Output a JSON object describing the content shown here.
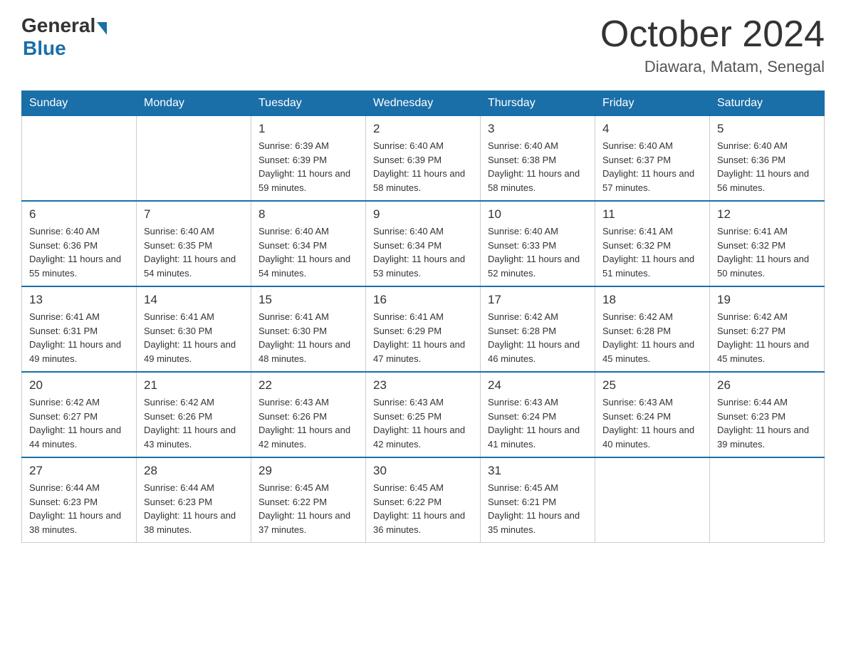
{
  "header": {
    "logo": {
      "general": "General",
      "blue": "Blue"
    },
    "title": "October 2024",
    "location": "Diawara, Matam, Senegal"
  },
  "days_of_week": [
    "Sunday",
    "Monday",
    "Tuesday",
    "Wednesday",
    "Thursday",
    "Friday",
    "Saturday"
  ],
  "weeks": [
    [
      {
        "day": "",
        "sunrise": "",
        "sunset": "",
        "daylight": ""
      },
      {
        "day": "",
        "sunrise": "",
        "sunset": "",
        "daylight": ""
      },
      {
        "day": "1",
        "sunrise": "Sunrise: 6:39 AM",
        "sunset": "Sunset: 6:39 PM",
        "daylight": "Daylight: 11 hours and 59 minutes."
      },
      {
        "day": "2",
        "sunrise": "Sunrise: 6:40 AM",
        "sunset": "Sunset: 6:39 PM",
        "daylight": "Daylight: 11 hours and 58 minutes."
      },
      {
        "day": "3",
        "sunrise": "Sunrise: 6:40 AM",
        "sunset": "Sunset: 6:38 PM",
        "daylight": "Daylight: 11 hours and 58 minutes."
      },
      {
        "day": "4",
        "sunrise": "Sunrise: 6:40 AM",
        "sunset": "Sunset: 6:37 PM",
        "daylight": "Daylight: 11 hours and 57 minutes."
      },
      {
        "day": "5",
        "sunrise": "Sunrise: 6:40 AM",
        "sunset": "Sunset: 6:36 PM",
        "daylight": "Daylight: 11 hours and 56 minutes."
      }
    ],
    [
      {
        "day": "6",
        "sunrise": "Sunrise: 6:40 AM",
        "sunset": "Sunset: 6:36 PM",
        "daylight": "Daylight: 11 hours and 55 minutes."
      },
      {
        "day": "7",
        "sunrise": "Sunrise: 6:40 AM",
        "sunset": "Sunset: 6:35 PM",
        "daylight": "Daylight: 11 hours and 54 minutes."
      },
      {
        "day": "8",
        "sunrise": "Sunrise: 6:40 AM",
        "sunset": "Sunset: 6:34 PM",
        "daylight": "Daylight: 11 hours and 54 minutes."
      },
      {
        "day": "9",
        "sunrise": "Sunrise: 6:40 AM",
        "sunset": "Sunset: 6:34 PM",
        "daylight": "Daylight: 11 hours and 53 minutes."
      },
      {
        "day": "10",
        "sunrise": "Sunrise: 6:40 AM",
        "sunset": "Sunset: 6:33 PM",
        "daylight": "Daylight: 11 hours and 52 minutes."
      },
      {
        "day": "11",
        "sunrise": "Sunrise: 6:41 AM",
        "sunset": "Sunset: 6:32 PM",
        "daylight": "Daylight: 11 hours and 51 minutes."
      },
      {
        "day": "12",
        "sunrise": "Sunrise: 6:41 AM",
        "sunset": "Sunset: 6:32 PM",
        "daylight": "Daylight: 11 hours and 50 minutes."
      }
    ],
    [
      {
        "day": "13",
        "sunrise": "Sunrise: 6:41 AM",
        "sunset": "Sunset: 6:31 PM",
        "daylight": "Daylight: 11 hours and 49 minutes."
      },
      {
        "day": "14",
        "sunrise": "Sunrise: 6:41 AM",
        "sunset": "Sunset: 6:30 PM",
        "daylight": "Daylight: 11 hours and 49 minutes."
      },
      {
        "day": "15",
        "sunrise": "Sunrise: 6:41 AM",
        "sunset": "Sunset: 6:30 PM",
        "daylight": "Daylight: 11 hours and 48 minutes."
      },
      {
        "day": "16",
        "sunrise": "Sunrise: 6:41 AM",
        "sunset": "Sunset: 6:29 PM",
        "daylight": "Daylight: 11 hours and 47 minutes."
      },
      {
        "day": "17",
        "sunrise": "Sunrise: 6:42 AM",
        "sunset": "Sunset: 6:28 PM",
        "daylight": "Daylight: 11 hours and 46 minutes."
      },
      {
        "day": "18",
        "sunrise": "Sunrise: 6:42 AM",
        "sunset": "Sunset: 6:28 PM",
        "daylight": "Daylight: 11 hours and 45 minutes."
      },
      {
        "day": "19",
        "sunrise": "Sunrise: 6:42 AM",
        "sunset": "Sunset: 6:27 PM",
        "daylight": "Daylight: 11 hours and 45 minutes."
      }
    ],
    [
      {
        "day": "20",
        "sunrise": "Sunrise: 6:42 AM",
        "sunset": "Sunset: 6:27 PM",
        "daylight": "Daylight: 11 hours and 44 minutes."
      },
      {
        "day": "21",
        "sunrise": "Sunrise: 6:42 AM",
        "sunset": "Sunset: 6:26 PM",
        "daylight": "Daylight: 11 hours and 43 minutes."
      },
      {
        "day": "22",
        "sunrise": "Sunrise: 6:43 AM",
        "sunset": "Sunset: 6:26 PM",
        "daylight": "Daylight: 11 hours and 42 minutes."
      },
      {
        "day": "23",
        "sunrise": "Sunrise: 6:43 AM",
        "sunset": "Sunset: 6:25 PM",
        "daylight": "Daylight: 11 hours and 42 minutes."
      },
      {
        "day": "24",
        "sunrise": "Sunrise: 6:43 AM",
        "sunset": "Sunset: 6:24 PM",
        "daylight": "Daylight: 11 hours and 41 minutes."
      },
      {
        "day": "25",
        "sunrise": "Sunrise: 6:43 AM",
        "sunset": "Sunset: 6:24 PM",
        "daylight": "Daylight: 11 hours and 40 minutes."
      },
      {
        "day": "26",
        "sunrise": "Sunrise: 6:44 AM",
        "sunset": "Sunset: 6:23 PM",
        "daylight": "Daylight: 11 hours and 39 minutes."
      }
    ],
    [
      {
        "day": "27",
        "sunrise": "Sunrise: 6:44 AM",
        "sunset": "Sunset: 6:23 PM",
        "daylight": "Daylight: 11 hours and 38 minutes."
      },
      {
        "day": "28",
        "sunrise": "Sunrise: 6:44 AM",
        "sunset": "Sunset: 6:23 PM",
        "daylight": "Daylight: 11 hours and 38 minutes."
      },
      {
        "day": "29",
        "sunrise": "Sunrise: 6:45 AM",
        "sunset": "Sunset: 6:22 PM",
        "daylight": "Daylight: 11 hours and 37 minutes."
      },
      {
        "day": "30",
        "sunrise": "Sunrise: 6:45 AM",
        "sunset": "Sunset: 6:22 PM",
        "daylight": "Daylight: 11 hours and 36 minutes."
      },
      {
        "day": "31",
        "sunrise": "Sunrise: 6:45 AM",
        "sunset": "Sunset: 6:21 PM",
        "daylight": "Daylight: 11 hours and 35 minutes."
      },
      {
        "day": "",
        "sunrise": "",
        "sunset": "",
        "daylight": ""
      },
      {
        "day": "",
        "sunrise": "",
        "sunset": "",
        "daylight": ""
      }
    ]
  ]
}
